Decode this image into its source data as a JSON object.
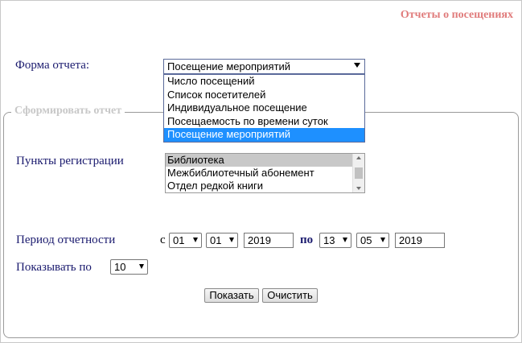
{
  "page_title": "Отчеты о посещениях",
  "report_form": {
    "label": "Форма отчета:",
    "selected": "Посещение мероприятий",
    "options": [
      "Число посещений",
      "Список посетителей",
      "Индивидуальное посещение",
      "Посещаемость по времени суток",
      "Посещение мероприятий"
    ]
  },
  "fieldset_legend": "Сформировать отчет",
  "registration": {
    "label": "Пункты регистрации",
    "items": [
      "Библиотека",
      "Межбиблиотечный абонемент",
      "Отдел редкой книги"
    ]
  },
  "period": {
    "label": "Период отчетности",
    "from_label": "с",
    "from_day": "01",
    "from_month": "01",
    "from_year": "2019",
    "to_label": "по",
    "to_day": "13",
    "to_month": "05",
    "to_year": "2019"
  },
  "show_by": {
    "label": "Показывать по",
    "value": "10"
  },
  "buttons": {
    "show": "Показать",
    "clear": "Очистить"
  }
}
